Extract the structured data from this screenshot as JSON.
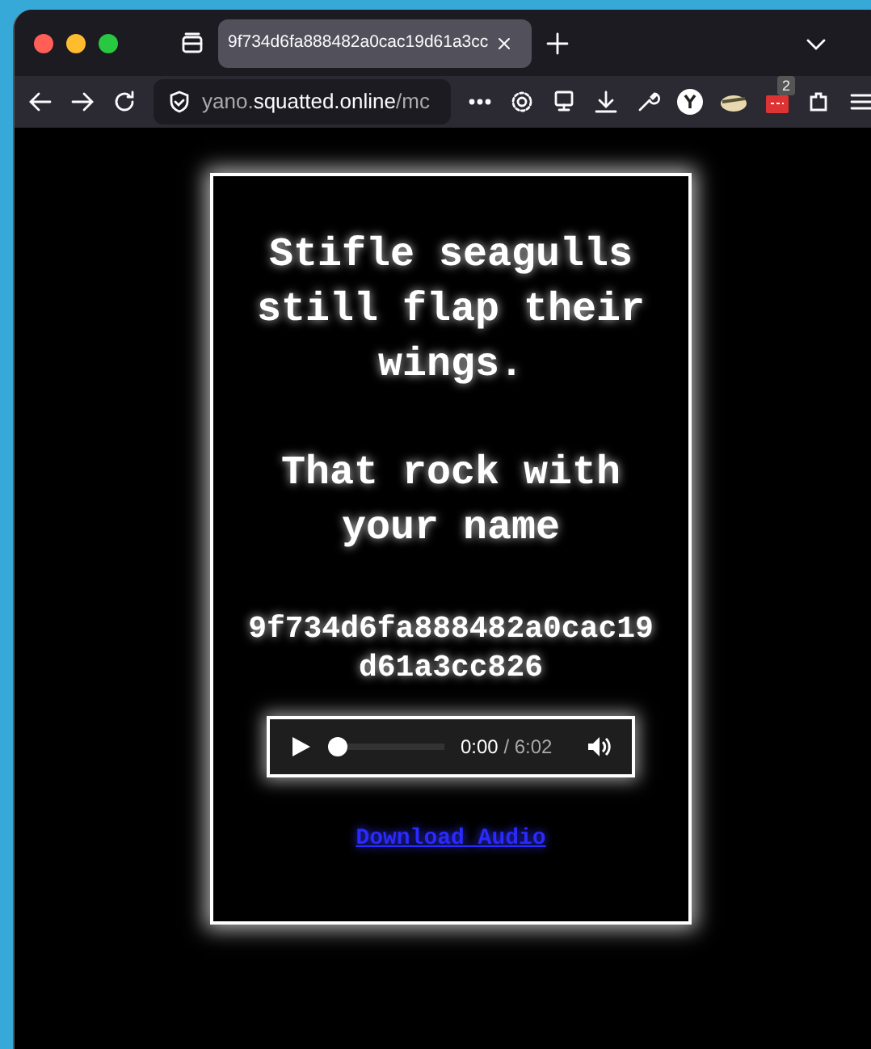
{
  "browser": {
    "tab": {
      "title": "9f734d6fa888482a0cac19d61a3cc",
      "selected": true
    },
    "url": {
      "subdomain": "yano.",
      "domain": "squatted.online",
      "path": "/mc"
    },
    "extension_badge": "2"
  },
  "page": {
    "heading": "Stifle seagulls still flap their wings.",
    "subheading": "That rock with your name",
    "hash": "9f734d6fa888482a0cac19d61a3cc826",
    "audio": {
      "current": "0:00",
      "separator": " / ",
      "total": "6:02",
      "level": 0
    },
    "download_link": "Download Audio"
  }
}
